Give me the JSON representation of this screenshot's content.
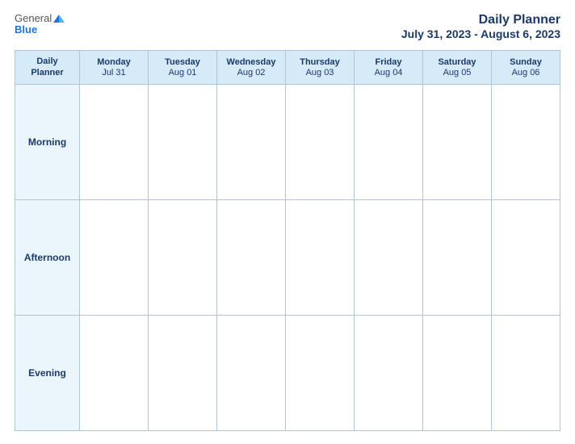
{
  "header": {
    "logo": {
      "general": "General",
      "blue": "Blue"
    },
    "title": "Daily Planner",
    "dates": "July 31, 2023 - August 6, 2023"
  },
  "table": {
    "header_col": {
      "label": "Daily",
      "label2": "Planner"
    },
    "days": [
      {
        "name": "Monday",
        "date": "Jul 31"
      },
      {
        "name": "Tuesday",
        "date": "Aug 01"
      },
      {
        "name": "Wednesday",
        "date": "Aug 02"
      },
      {
        "name": "Thursday",
        "date": "Aug 03"
      },
      {
        "name": "Friday",
        "date": "Aug 04"
      },
      {
        "name": "Saturday",
        "date": "Aug 05"
      },
      {
        "name": "Sunday",
        "date": "Aug 06"
      }
    ],
    "rows": [
      {
        "label": "Morning"
      },
      {
        "label": "Afternoon"
      },
      {
        "label": "Evening"
      }
    ]
  }
}
